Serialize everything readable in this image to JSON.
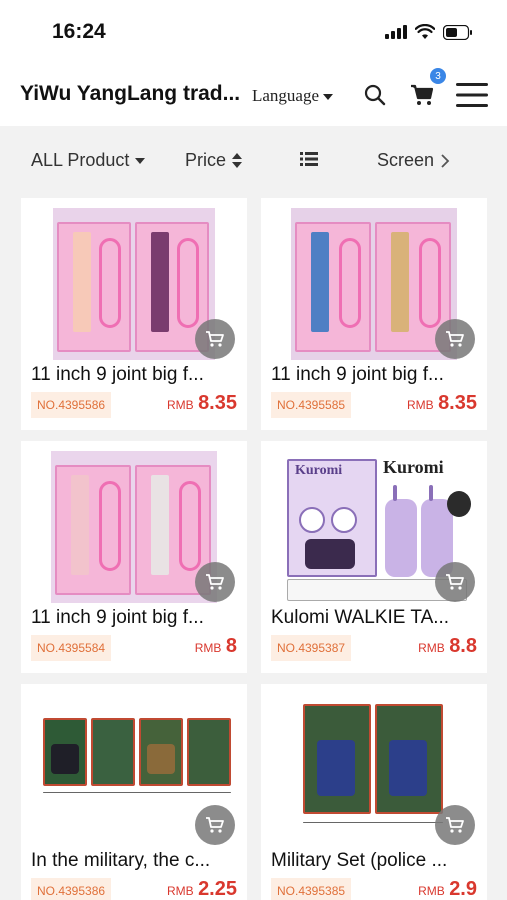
{
  "status_bar": {
    "time": "16:24"
  },
  "header": {
    "shop_name": "YiWu YangLang trad...",
    "language_label": "Language",
    "cart_count": "3",
    "icons": [
      "search-icon",
      "cart-icon",
      "menu-icon"
    ]
  },
  "filters": {
    "all_product": "ALL Product",
    "price": "Price",
    "screen": "Screen"
  },
  "products": [
    {
      "title": "11 inch 9 joint big f...",
      "no": "NO.4395586",
      "currency": "RMB",
      "price": "8.35"
    },
    {
      "title": "11 inch 9 joint big f...",
      "no": "NO.4395585",
      "currency": "RMB",
      "price": "8.35"
    },
    {
      "title": "11 inch 9 joint big f...",
      "no": "NO.4395584",
      "currency": "RMB",
      "price": "8"
    },
    {
      "title": "Kulomi WALKIE TA...",
      "no": "NO.4395387",
      "currency": "RMB",
      "price": "8.8",
      "image_text": "Kuromi"
    },
    {
      "title": "In the military, the c...",
      "no": "NO.4395386",
      "currency": "RMB",
      "price": "2.25"
    },
    {
      "title": "Military Set (police ...",
      "no": "NO.4395385",
      "currency": "RMB",
      "price": "2.9"
    }
  ],
  "colors": {
    "accent_badge": "#3a86e6",
    "price_red": "#d9382e",
    "tag_orange": "#e0703a",
    "tag_bg": "#fdeee3"
  }
}
